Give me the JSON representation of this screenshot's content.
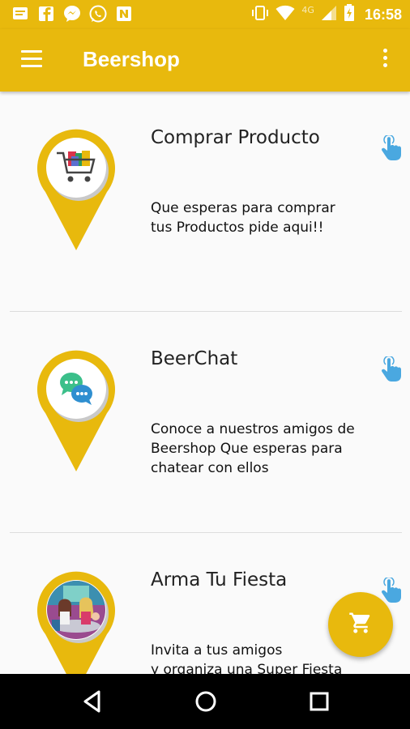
{
  "status_bar": {
    "time": "16:58",
    "network": "4G",
    "left_icons": [
      "message-icon",
      "facebook-icon",
      "messenger-icon",
      "whatsapp-icon",
      "n-app-icon"
    ],
    "right_icons": [
      "vibrate-icon",
      "wifi-icon",
      "signal-icon",
      "battery-icon"
    ]
  },
  "app_bar": {
    "title": "Beershop",
    "menu_icon": "hamburger-menu-icon",
    "overflow_icon": "more-vert-icon"
  },
  "cards": [
    {
      "title": "Comprar Producto",
      "description": "Que esperas para comprar\ntus Productos pide aqui!!",
      "icon": "shopping-cart-icon"
    },
    {
      "title": "BeerChat",
      "description": "Conoce a nuestros amigos de Beershop Que esperas para chatear con ellos",
      "icon": "chat-bubbles-icon"
    },
    {
      "title": "Arma Tu Fiesta",
      "description": "Invita a tus amigos\ny organiza una Super Fiesta",
      "icon": "party-people-icon"
    }
  ],
  "fab": {
    "icon": "cart-icon"
  },
  "nav_bar": {
    "buttons": [
      "back-icon",
      "home-icon",
      "recents-icon"
    ]
  },
  "colors": {
    "accent": "#e8b90d",
    "tap_icon": "#4aa8e0",
    "background": "#fafafa"
  }
}
